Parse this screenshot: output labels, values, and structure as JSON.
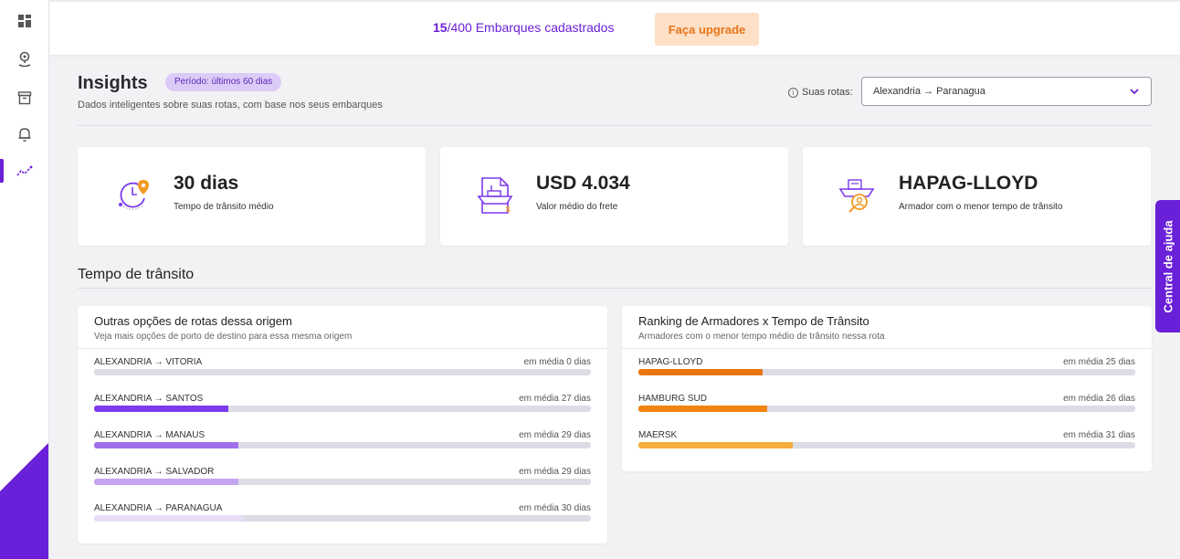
{
  "colors": {
    "accent": "#6a1fd8",
    "upgrade_bg": "#fde0c6",
    "upgrade_text": "#e8751a"
  },
  "sidebar": {
    "items": [
      {
        "icon": "dashboard-grid-icon"
      },
      {
        "icon": "location-pin-icon"
      },
      {
        "icon": "archive-box-icon"
      },
      {
        "icon": "bell-icon"
      },
      {
        "icon": "insights-chart-icon",
        "active": true
      }
    ]
  },
  "topbar": {
    "count_current": "15",
    "count_rest": "/400 Embarques cadastrados",
    "upgrade_label": "Faça upgrade"
  },
  "header": {
    "title": "Insights",
    "period_badge": "Período: últimos 60 dias",
    "subtitle": "Dados inteligentes sobre suas rotas, com base nos seus embarques",
    "routes_label": "Suas rotas:",
    "route_selected": "Alexandria → Paranagua"
  },
  "stats": [
    {
      "icon": "clock-pin-icon",
      "value": "30 dias",
      "label": "Tempo de trânsito médio"
    },
    {
      "icon": "ship-invoice-icon",
      "value": "USD 4.034",
      "label": "Valor médio do frete"
    },
    {
      "icon": "carrier-search-icon",
      "value": "HAPAG-LLOYD",
      "label": "Armador com o menor tempo de trânsito"
    }
  ],
  "section": {
    "title": "Tempo de trânsito"
  },
  "routes_card": {
    "title": "Outras opções de rotas dessa origem",
    "subtitle": "Veja mais opções de porto de destino para essa mesma origem",
    "rows": [
      {
        "name": "ALEXANDRIA → VITORIA",
        "value_label": "em média 0 dias",
        "days": 0,
        "color": "#7c3aed"
      },
      {
        "name": "ALEXANDRIA → SANTOS",
        "value_label": "em média 27 dias",
        "days": 27,
        "color": "#7c3aed"
      },
      {
        "name": "ALEXANDRIA → MANAUS",
        "value_label": "em média 29 dias",
        "days": 29,
        "color": "#a070ea"
      },
      {
        "name": "ALEXANDRIA → SALVADOR",
        "value_label": "em média 29 dias",
        "days": 29,
        "color": "#c5a4f1"
      },
      {
        "name": "ALEXANDRIA → PARANAGUA",
        "value_label": "em média 30 dias",
        "days": 30,
        "color": "#e7dcf8"
      }
    ]
  },
  "ranking_card": {
    "title": "Ranking de Armadores x Tempo de Trânsito",
    "subtitle": "Armadores com o menor tempo médio de trânsito nessa rota",
    "rows": [
      {
        "name": "HAPAG-LLOYD",
        "value_label": "em média 25 dias",
        "days": 25,
        "color": "#e8760f"
      },
      {
        "name": "HAMBURG SUD",
        "value_label": "em média 26 dias",
        "days": 26,
        "color": "#f0840f"
      },
      {
        "name": "MAERSK",
        "value_label": "em média 31 dias",
        "days": 31,
        "color": "#f6ad3b"
      }
    ]
  },
  "help": {
    "label": "Central de ajuda"
  }
}
